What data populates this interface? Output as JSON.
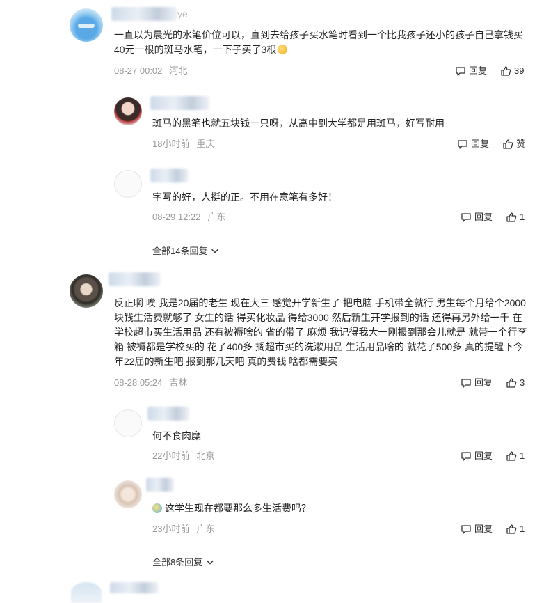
{
  "actions": {
    "reply": "回复",
    "like": "赞"
  },
  "comments": [
    {
      "text": "一直以为晨光的水笔价位可以，直到去给孩子买水笔时看到一个比我孩子还小的孩子自己拿钱买40元一根的斑马水笔，一下子买了3根",
      "time": "08-27 00:02",
      "location": "河北",
      "likes": "39",
      "replies": [
        {
          "text": "斑马的黑笔也就五块钱一只呀，从高中到大学都是用斑马，好写耐用",
          "time": "18小时前",
          "location": "重庆",
          "likes": "赞"
        },
        {
          "text": "字写的好，人挺的正。不用在意笔有多好！",
          "time": "08-29 12:22",
          "location": "广东",
          "likes": "1"
        }
      ],
      "more_replies": "全部14条回复"
    },
    {
      "text": "反正啊 唉 我是20届的老生 现在大三 感觉开学新生了 把电脑 手机带全就行 男生每个月给个2000块钱生活费就够了 女生的话 得买化妆品 得给3000 然后新生开学报到的话 还得再另外给一千 在学校超市买生活用品 还有被褥啥的 省的带了 麻烦 我记得我大一刚报到那会儿就是 就带一个行李箱 被褥都是学校买的 花了400多 搁超市买的洗漱用品 生活用品啥的 就花了500多 真的提醒下今年22届的新生吧 报到那几天吧 真的费钱 啥都需要买",
      "time": "08-28 05:24",
      "location": "吉林",
      "likes": "3",
      "replies": [
        {
          "text": "何不食肉糜",
          "time": "22小时前",
          "location": "北京",
          "likes": "1"
        },
        {
          "text": "这学生现在都要那么多生活费吗？",
          "time": "23小时前",
          "location": "广东",
          "likes": "1"
        }
      ],
      "more_replies": "全部8条回复"
    }
  ],
  "partial_username_suffix": "ye"
}
